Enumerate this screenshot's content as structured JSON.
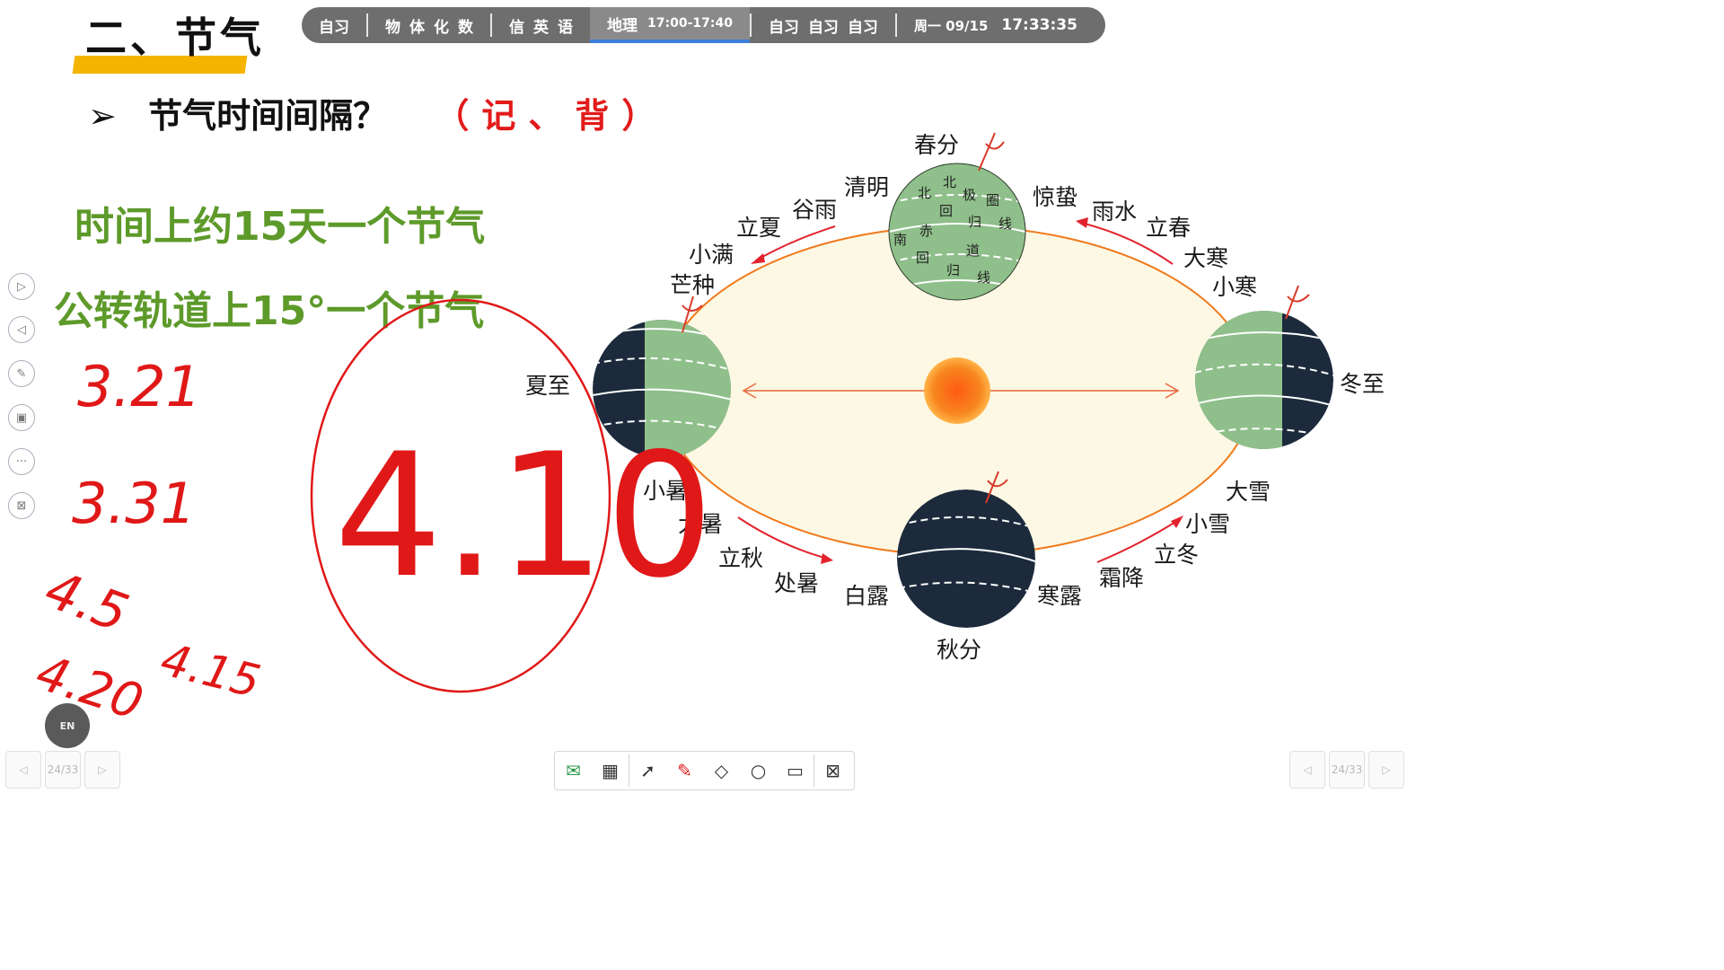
{
  "title": "二、节气",
  "schedule": {
    "segments": [
      [
        "自习"
      ],
      [
        "物",
        "体",
        "化",
        "数"
      ],
      [
        "信",
        "英",
        "语"
      ]
    ],
    "active_subject": "地理",
    "active_time": "17:00-17:40",
    "after": [
      "自习",
      "自习",
      "自习"
    ],
    "weekday_date": "周一 09/15",
    "clock": "17:33:35"
  },
  "question": {
    "arrow": "➢",
    "text": "节气时间间隔？",
    "mark": "（记、背）"
  },
  "line1": "时间上约15天一个节气",
  "line2": "公转轨道上15°一个节气",
  "handwriting": {
    "a": "3.21",
    "b": "3.31",
    "c": "4.5",
    "d": "4.20",
    "e": "4.15",
    "big": "4.10"
  },
  "diagram": {
    "solar_terms": {
      "chunfen": "春分",
      "qingming": "清明",
      "guyu": "谷雨",
      "lixia": "立夏",
      "xiaoman": "小满",
      "mangzhong": "芒种",
      "xiazhi": "夏至",
      "xiaoshu": "小暑",
      "dashu": "大暑",
      "liqiu": "立秋",
      "chushu": "处暑",
      "bailu": "白露",
      "qiufen": "秋分",
      "hanlu": "寒露",
      "shuangjiang": "霜降",
      "lidong": "立冬",
      "xiaoxue": "小雪",
      "daxue": "大雪",
      "dongzhi": "冬至",
      "xiaohan": "小寒",
      "dahan": "大寒",
      "lichun": "立春",
      "yushui": "雨水",
      "jingzhe": "惊蛰"
    },
    "globe_labels": {
      "bei1": "北",
      "bei2": "北",
      "ji": "极",
      "quan": "圈",
      "hui1": "回",
      "gui1": "归",
      "xian1": "线",
      "nan": "南",
      "chi": "赤",
      "dao": "道",
      "hui2": "回",
      "gui2": "归",
      "xian2": "线"
    }
  },
  "toolbar": {
    "page_left": "24/33",
    "page_right": "24/33"
  },
  "en_badge": "EN"
}
